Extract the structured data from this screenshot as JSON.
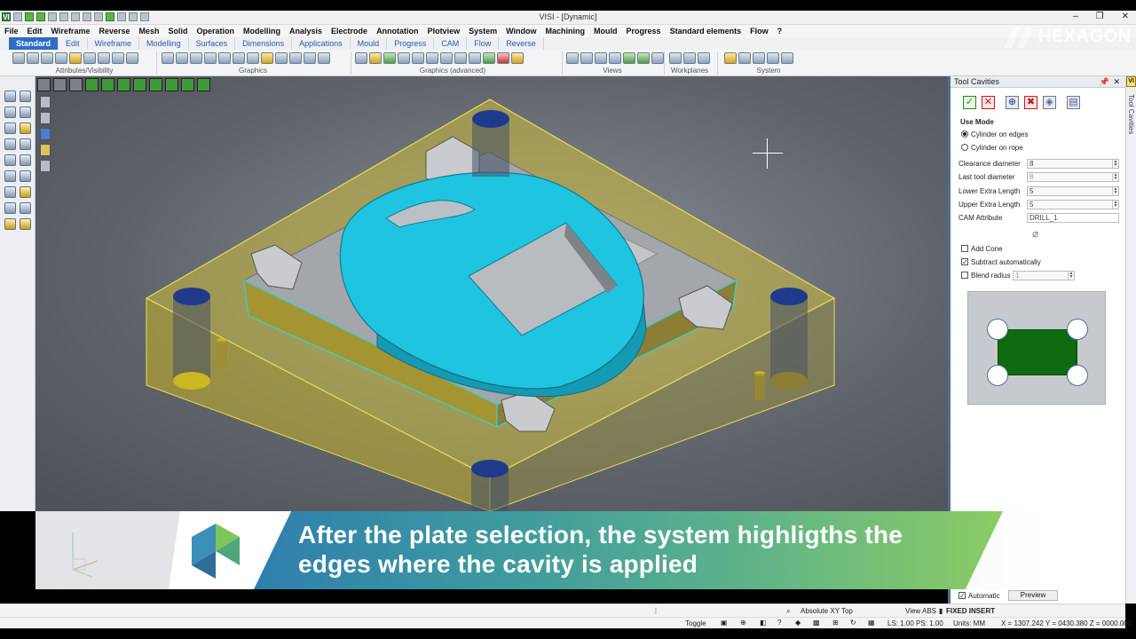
{
  "window": {
    "title": "VISI - [Dynamic]",
    "logo": "VI",
    "controls": [
      "–",
      "❐",
      "✕"
    ]
  },
  "brand": {
    "name": "HEXAGON"
  },
  "menu": [
    "File",
    "Edit",
    "Wireframe",
    "Reverse",
    "Mesh",
    "Solid",
    "Operation",
    "Modelling",
    "Analysis",
    "Electrode",
    "Annotation",
    "Plotview",
    "System",
    "Window",
    "Machining",
    "Mould",
    "Progress",
    "Standard elements",
    "Flow",
    "?"
  ],
  "tabs": [
    "Standard",
    "Edit",
    "Wireframe",
    "Modelling",
    "Surfaces",
    "Dimensions",
    "Applications",
    "Mould",
    "Progress",
    "CAM",
    "Flow",
    "Reverse"
  ],
  "ribbon_groups": [
    "Attributes/Visibility",
    "Graphics",
    "Graphics (advanced)",
    "Views",
    "Workplanes",
    "System"
  ],
  "panel": {
    "title": "Tool Cavities",
    "side_tab": "Tool Cavities",
    "side_tab_logo": "VI",
    "use_mode_label": "Use Mode",
    "mode_options": [
      "Cylinder on edges",
      "Cylinder on rope"
    ],
    "fields": [
      {
        "label": "Clearance diameter",
        "value": "8"
      },
      {
        "label": "Last tool diameter",
        "value": "8"
      },
      {
        "label": "Lower Extra Length",
        "value": "5"
      },
      {
        "label": "Upper Extra Length",
        "value": "5"
      },
      {
        "label": "CAM Attribute",
        "value": "DRILL_1"
      }
    ],
    "checkboxes": [
      {
        "label": "Add Cone",
        "checked": false
      },
      {
        "label": "Subtract automatically",
        "checked": true
      },
      {
        "label": "Blend radius",
        "checked": false,
        "value": "1"
      }
    ],
    "automatic_label": "Automatic",
    "preview_button": "Preview"
  },
  "caption": "After the plate selection, the system highligths the edges where the cavity is applied",
  "status": {
    "toggle": "Toggle",
    "view_mode": "Absolute XY Top",
    "view_abs": "View ABS",
    "insert_mode": "FIXED INSERT",
    "ls_ps": "LS: 1.00 PS: 1.00",
    "units": "Units: MM",
    "coords": "X = 1307.242 Y = 0430.380 Z = 0000.000"
  },
  "colors": {
    "accent_blue": "#2e6cc6",
    "part_cyan": "#1fc4e0",
    "plate_yellow": "#c9b81f",
    "preview_green": "#0e6b10"
  }
}
